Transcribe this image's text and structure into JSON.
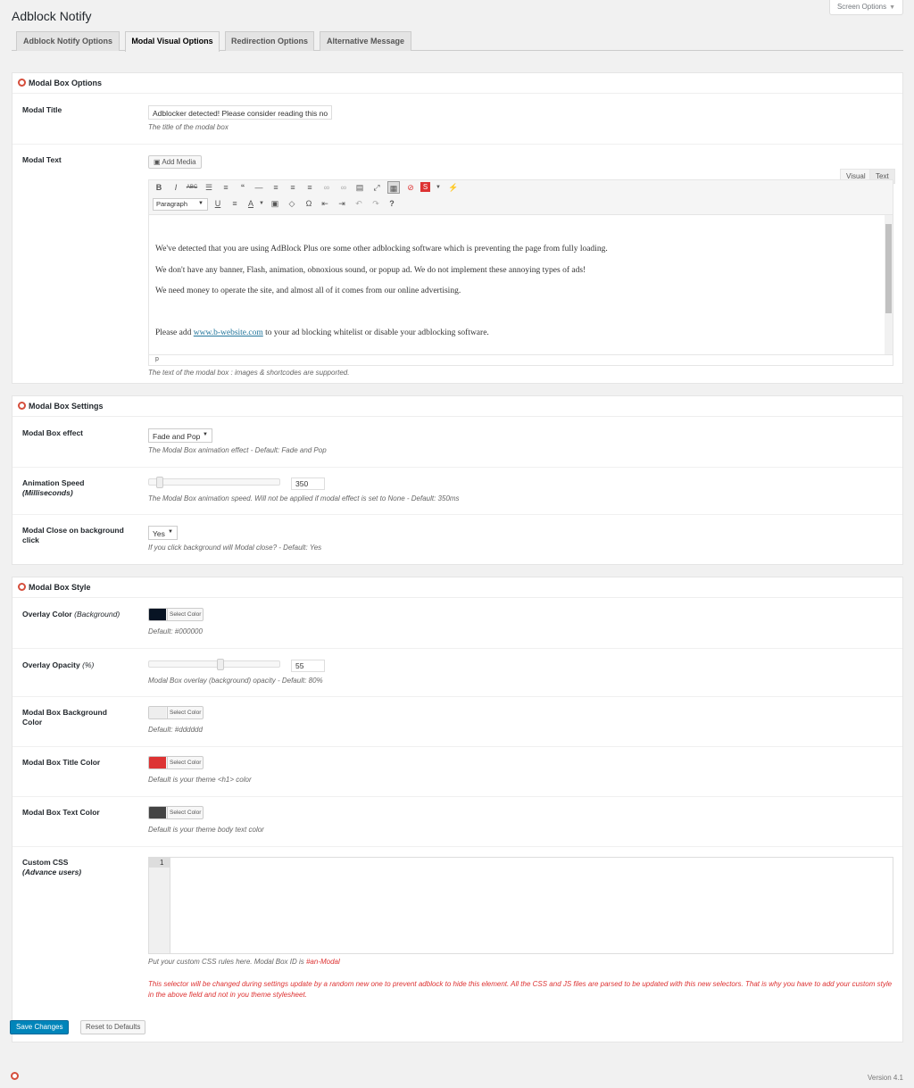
{
  "page_title": "Adblock Notify",
  "screen_options": "Screen Options",
  "tabs": [
    "Adblock Notify Options",
    "Modal Visual Options",
    "Redirection Options",
    "Alternative Message"
  ],
  "active_tab": "Modal Visual Options",
  "sections": {
    "options": {
      "title": "Modal Box Options",
      "modal_title": {
        "label": "Modal Title",
        "value": "Adblocker detected! Please consider reading this no",
        "desc": "The title of the modal box"
      },
      "modal_text": {
        "label": "Modal Text",
        "add_media": "Add Media",
        "mode_visual": "Visual",
        "mode_text": "Text",
        "format": "Paragraph",
        "para1": "We've detected that you are using AdBlock Plus ore some other adblocking software which is preventing the page from fully loading.",
        "para2": "We don't have any banner, Flash, animation, obnoxious sound, or popup ad. We do not implement these annoying types of ads!",
        "para3": "We need money to operate the site, and almost all of it comes from our online advertising.",
        "para4_pre": "Please add ",
        "para4_link": "www.b-website.com",
        "para4_post": " to your ad blocking whitelist or disable your adblocking software.",
        "path": "p",
        "desc": "The text of the modal box : images & shortcodes are supported."
      }
    },
    "settings": {
      "title": "Modal Box Settings",
      "effect": {
        "label": "Modal Box effect",
        "value": "Fade and Pop",
        "desc": "The Modal Box animation effect - Default: Fade and Pop"
      },
      "speed": {
        "label": "Animation Speed",
        "label_sub": "(Milliseconds)",
        "value": "350",
        "level": 0.06,
        "desc": "The Modal Box animation speed. Will not be applied if modal effect is set to None - Default: 350ms"
      },
      "close": {
        "label": "Modal Close on background click",
        "value": "Yes",
        "desc": "If you click background will Modal close? - Default: Yes"
      }
    },
    "style": {
      "title": "Modal Box Style",
      "select_color": "Select Color",
      "overlay_color": {
        "label": "Overlay Color",
        "label_sub": "(Background)",
        "color": "#081424",
        "desc": "Default: #000000"
      },
      "overlay_opacity": {
        "label": "Overlay Opacity",
        "label_sub": "(%)",
        "value": "55",
        "level": 0.55,
        "desc": "Modal Box overlay (background) opacity - Default: 80%"
      },
      "bg_color": {
        "label": "Modal Box Background Color",
        "color": "#eeeeee",
        "desc": "Default: #dddddd"
      },
      "title_color": {
        "label": "Modal Box Title Color",
        "color": "#dd3333",
        "desc": "Default is your theme <h1> color"
      },
      "text_color": {
        "label": "Modal Box Text Color",
        "color": "#444444",
        "desc": "Default is your theme body text color"
      },
      "custom_css": {
        "label": "Custom CSS",
        "label_sub": "(Advance users)",
        "line_number": "1",
        "desc_pre": "Put your custom CSS rules here. Modal Box ID is ",
        "desc_id": "#an-Modal",
        "warning": "This selector will be changed during settings update by a random new one to prevent adblock to hide this element. All the CSS and JS files are parsed to be updated with this new selectors. That is why you have to add your custom style in the above field and not in you theme stylesheet."
      }
    }
  },
  "buttons": {
    "save": "Save Changes",
    "reset": "Reset to Defaults"
  },
  "footer": {
    "version": "Version 4.1"
  }
}
